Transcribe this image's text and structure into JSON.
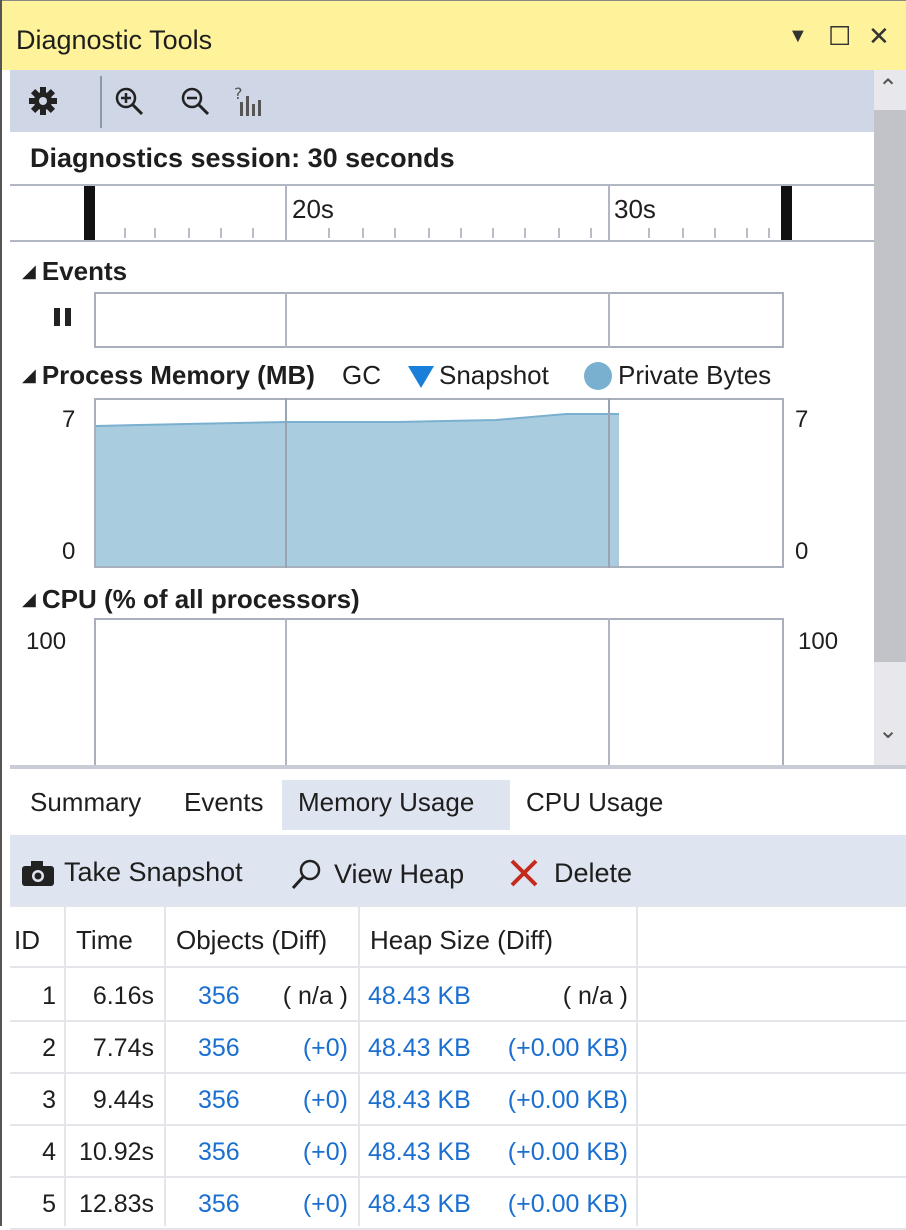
{
  "window": {
    "title": "Diagnostic Tools",
    "controls": {
      "dropdown": "▼",
      "maximize": "☐",
      "close": "✕"
    }
  },
  "toolbar": {
    "icons": [
      "gear-icon",
      "zoom-in-icon",
      "zoom-out-icon",
      "reset-zoom-icon"
    ]
  },
  "session": {
    "label": "Diagnostics session: 30 seconds",
    "ruler_labels": [
      "20s",
      "30s"
    ]
  },
  "events": {
    "title": "Events",
    "pause_icon": "pause-icon"
  },
  "memory": {
    "title": "Process Memory (MB)",
    "legend": {
      "gc": "GC",
      "snapshot": "Snapshot",
      "private_bytes": "Private Bytes"
    },
    "y_max": "7",
    "y_min": "0",
    "colors": {
      "fill": "#a9ccdf",
      "snapshot": "#1a7fd8",
      "private_bytes": "#7ab0cf"
    }
  },
  "cpu": {
    "title": "CPU (% of all processors)",
    "y_max": "100"
  },
  "tabs": [
    "Summary",
    "Events",
    "Memory Usage",
    "CPU Usage"
  ],
  "active_tab": "Memory Usage",
  "actions": {
    "take_snapshot": "Take Snapshot",
    "view_heap": "View Heap",
    "delete": "Delete"
  },
  "table": {
    "headers": [
      "ID",
      "Time",
      "Objects (Diff)",
      "Heap Size (Diff)"
    ],
    "rows": [
      {
        "id": "1",
        "time": "6.16s",
        "objects": "356",
        "objects_diff": "( n/a )",
        "heap": "48.43 KB",
        "heap_diff": "( n/a )"
      },
      {
        "id": "2",
        "time": "7.74s",
        "objects": "356",
        "objects_diff": "(+0)",
        "heap": "48.43 KB",
        "heap_diff": "(+0.00 KB)"
      },
      {
        "id": "3",
        "time": "9.44s",
        "objects": "356",
        "objects_diff": "(+0)",
        "heap": "48.43 KB",
        "heap_diff": "(+0.00 KB)"
      },
      {
        "id": "4",
        "time": "10.92s",
        "objects": "356",
        "objects_diff": "(+0)",
        "heap": "48.43 KB",
        "heap_diff": "(+0.00 KB)"
      },
      {
        "id": "5",
        "time": "12.83s",
        "objects": "356",
        "objects_diff": "(+0)",
        "heap": "48.43 KB",
        "heap_diff": "(+0.00 KB)"
      }
    ]
  }
}
